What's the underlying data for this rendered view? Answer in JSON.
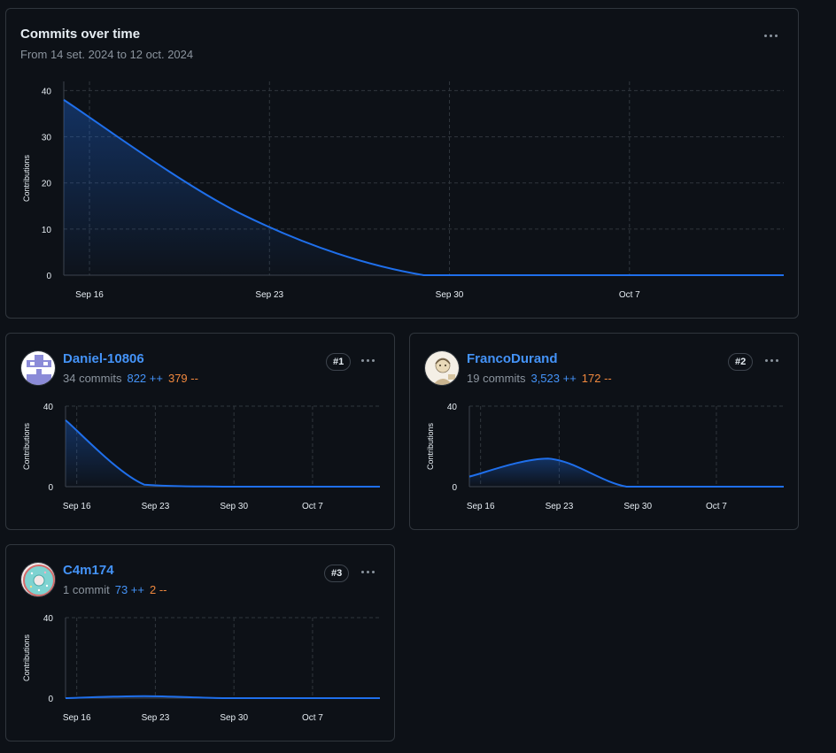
{
  "main": {
    "title": "Commits over time",
    "subtitle": "From 14 set. 2024 to 12 oct. 2024"
  },
  "contributors": [
    {
      "name": "Daniel-10806",
      "commits": "34 commits",
      "additions": "822 ++",
      "deletions": "379 --",
      "rank": "#1"
    },
    {
      "name": "FrancoDurand",
      "commits": "19 commits",
      "additions": "3,523 ++",
      "deletions": "172 --",
      "rank": "#2"
    },
    {
      "name": "C4m174",
      "commits": "1 commit",
      "additions": "73 ++",
      "deletions": "2 --",
      "rank": "#3"
    }
  ],
  "colors": {
    "line": "#1f6feb",
    "link": "#4493f8",
    "additions": "#4493f8",
    "deletions": "#f0883e",
    "grid": "#30363d",
    "background": "#0d1117"
  },
  "chart_data": [
    {
      "type": "area",
      "ylabel": "Contributions",
      "ylim": [
        0,
        42
      ],
      "yticks": [
        0,
        10,
        20,
        30,
        40
      ],
      "xticks": [
        "Sep 16",
        "Sep 23",
        "Sep 30",
        "Oct 7"
      ],
      "xtick_dates": [
        "2024-09-16",
        "2024-09-23",
        "2024-09-30",
        "2024-10-07"
      ],
      "x": [
        "2024-09-15",
        "2024-09-22",
        "2024-09-29",
        "2024-10-06",
        "2024-10-13"
      ],
      "values": [
        38,
        13,
        0,
        0,
        0
      ],
      "grid": true
    },
    {
      "type": "area",
      "series": [
        {
          "name": "Daniel-10806",
          "values": [
            33,
            1,
            0,
            0,
            0
          ]
        }
      ],
      "ylabel": "Contributions",
      "ylim": [
        0,
        40
      ],
      "yticks": [
        0,
        40
      ],
      "xticks": [
        "Sep 16",
        "Sep 23",
        "Sep 30",
        "Oct 7"
      ],
      "xtick_dates": [
        "2024-09-16",
        "2024-09-23",
        "2024-09-30",
        "2024-10-07"
      ],
      "x": [
        "2024-09-15",
        "2024-09-22",
        "2024-09-29",
        "2024-10-06",
        "2024-10-13"
      ],
      "grid": true
    },
    {
      "type": "area",
      "series": [
        {
          "name": "FrancoDurand",
          "values": [
            5,
            14,
            0,
            0,
            0
          ]
        }
      ],
      "ylabel": "Contributions",
      "ylim": [
        0,
        40
      ],
      "yticks": [
        0,
        40
      ],
      "xticks": [
        "Sep 16",
        "Sep 23",
        "Sep 30",
        "Oct 7"
      ],
      "xtick_dates": [
        "2024-09-16",
        "2024-09-23",
        "2024-09-30",
        "2024-10-07"
      ],
      "x": [
        "2024-09-15",
        "2024-09-22",
        "2024-09-29",
        "2024-10-06",
        "2024-10-13"
      ],
      "grid": true
    },
    {
      "type": "area",
      "series": [
        {
          "name": "C4m174",
          "values": [
            0,
            1,
            0,
            0,
            0
          ]
        }
      ],
      "ylabel": "Contributions",
      "ylim": [
        0,
        40
      ],
      "yticks": [
        0,
        40
      ],
      "xticks": [
        "Sep 16",
        "Sep 23",
        "Sep 30",
        "Oct 7"
      ],
      "xtick_dates": [
        "2024-09-16",
        "2024-09-23",
        "2024-09-30",
        "2024-10-07"
      ],
      "x": [
        "2024-09-15",
        "2024-09-22",
        "2024-09-29",
        "2024-10-06",
        "2024-10-13"
      ],
      "grid": true
    }
  ]
}
